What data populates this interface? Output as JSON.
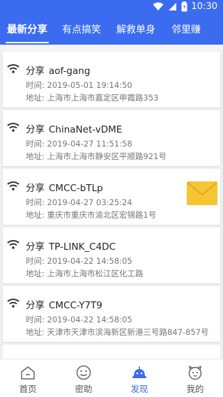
{
  "statusbar": {
    "time": "10:30"
  },
  "tabs": [
    {
      "label": "最新分享",
      "active": true
    },
    {
      "label": "有点搞笑",
      "active": false
    },
    {
      "label": "解救单身",
      "active": false
    },
    {
      "label": "邻里赚",
      "active": false
    }
  ],
  "share_prefix": "分享",
  "cards": [
    {
      "ssid": "aof-gang",
      "time": "时间: 2019-05-01 19:14:50",
      "address": "地址: 上海市上海市嘉定区申霞路353"
    },
    {
      "ssid": "ChinaNet-vDME",
      "time": "时间: 2019-04-27 11:51:58",
      "address": "地址: 上海市上海市静安区平顺路921号"
    },
    {
      "ssid": "CMCC-bTLp",
      "time": "时间: 2019-04-27 03:25:24",
      "address": "地址: 重庆市重庆市渝北区宏锦路1号",
      "has_message": true
    },
    {
      "ssid": "TP-LINK_C4DC",
      "time": "时间: 2019-04-22 14:58:05",
      "address": "地址: 上海市上海市松江区化工路"
    },
    {
      "ssid": "CMCC-Y7T9",
      "time": "时间: 2019-04-22 14:58:05",
      "address": "地址: 天津市天津市滨海新区新港三号路847-857号"
    }
  ],
  "nav": [
    {
      "label": "首页",
      "icon": "home-icon",
      "active": false
    },
    {
      "label": "密助",
      "icon": "chat-face-icon",
      "active": false
    },
    {
      "label": "发现",
      "icon": "discover-icon",
      "active": true
    },
    {
      "label": "我的",
      "icon": "profile-face-icon",
      "active": false
    }
  ],
  "colors": {
    "primary": "#3b6cf0",
    "mail": "#f6c533"
  }
}
